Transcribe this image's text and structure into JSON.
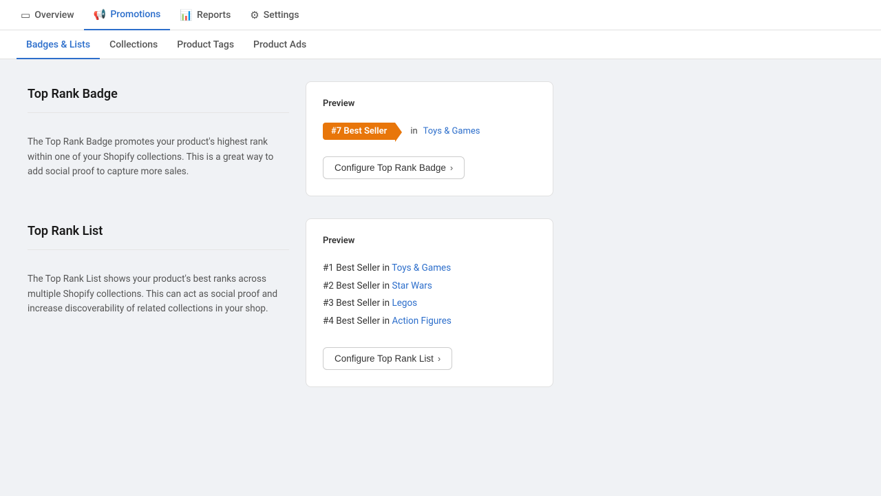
{
  "topNav": {
    "items": [
      {
        "id": "overview",
        "label": "Overview",
        "icon": "▭",
        "active": false
      },
      {
        "id": "promotions",
        "label": "Promotions",
        "icon": "📢",
        "active": true
      },
      {
        "id": "reports",
        "label": "Reports",
        "icon": "📊",
        "active": false
      },
      {
        "id": "settings",
        "label": "Settings",
        "icon": "⚙",
        "active": false
      }
    ]
  },
  "subNav": {
    "items": [
      {
        "id": "badges-lists",
        "label": "Badges & Lists",
        "active": true
      },
      {
        "id": "collections",
        "label": "Collections",
        "active": false
      },
      {
        "id": "product-tags",
        "label": "Product Tags",
        "active": false
      },
      {
        "id": "product-ads",
        "label": "Product Ads",
        "active": false
      }
    ]
  },
  "sections": {
    "badge": {
      "title": "Top Rank Badge",
      "description": "The Top Rank Badge promotes your product's highest rank within one of your Shopify collections. This is a great way to add social proof to capture more sales.",
      "preview": {
        "label": "Preview",
        "badgeText": "#7 Best Seller",
        "inText": "in",
        "collectionLink": "Toys & Games"
      },
      "configureButton": "Configure Top Rank Badge"
    },
    "list": {
      "title": "Top Rank List",
      "description": "The Top Rank List shows your product's best ranks across multiple Shopify collections. This can act as social proof and increase discoverability of related collections in your shop.",
      "preview": {
        "label": "Preview",
        "items": [
          {
            "rank": "#1 Best Seller in ",
            "collection": "Toys & Games"
          },
          {
            "rank": "#2 Best Seller in ",
            "collection": "Star Wars"
          },
          {
            "rank": "#3 Best Seller in ",
            "collection": "Legos"
          },
          {
            "rank": "#4 Best Seller in ",
            "collection": "Action Figures"
          }
        ]
      },
      "configureButton": "Configure Top Rank List"
    }
  },
  "icons": {
    "chevron": "›",
    "overview": "▭",
    "promotions": "📢",
    "reports": "📊",
    "settings": "⚙"
  }
}
